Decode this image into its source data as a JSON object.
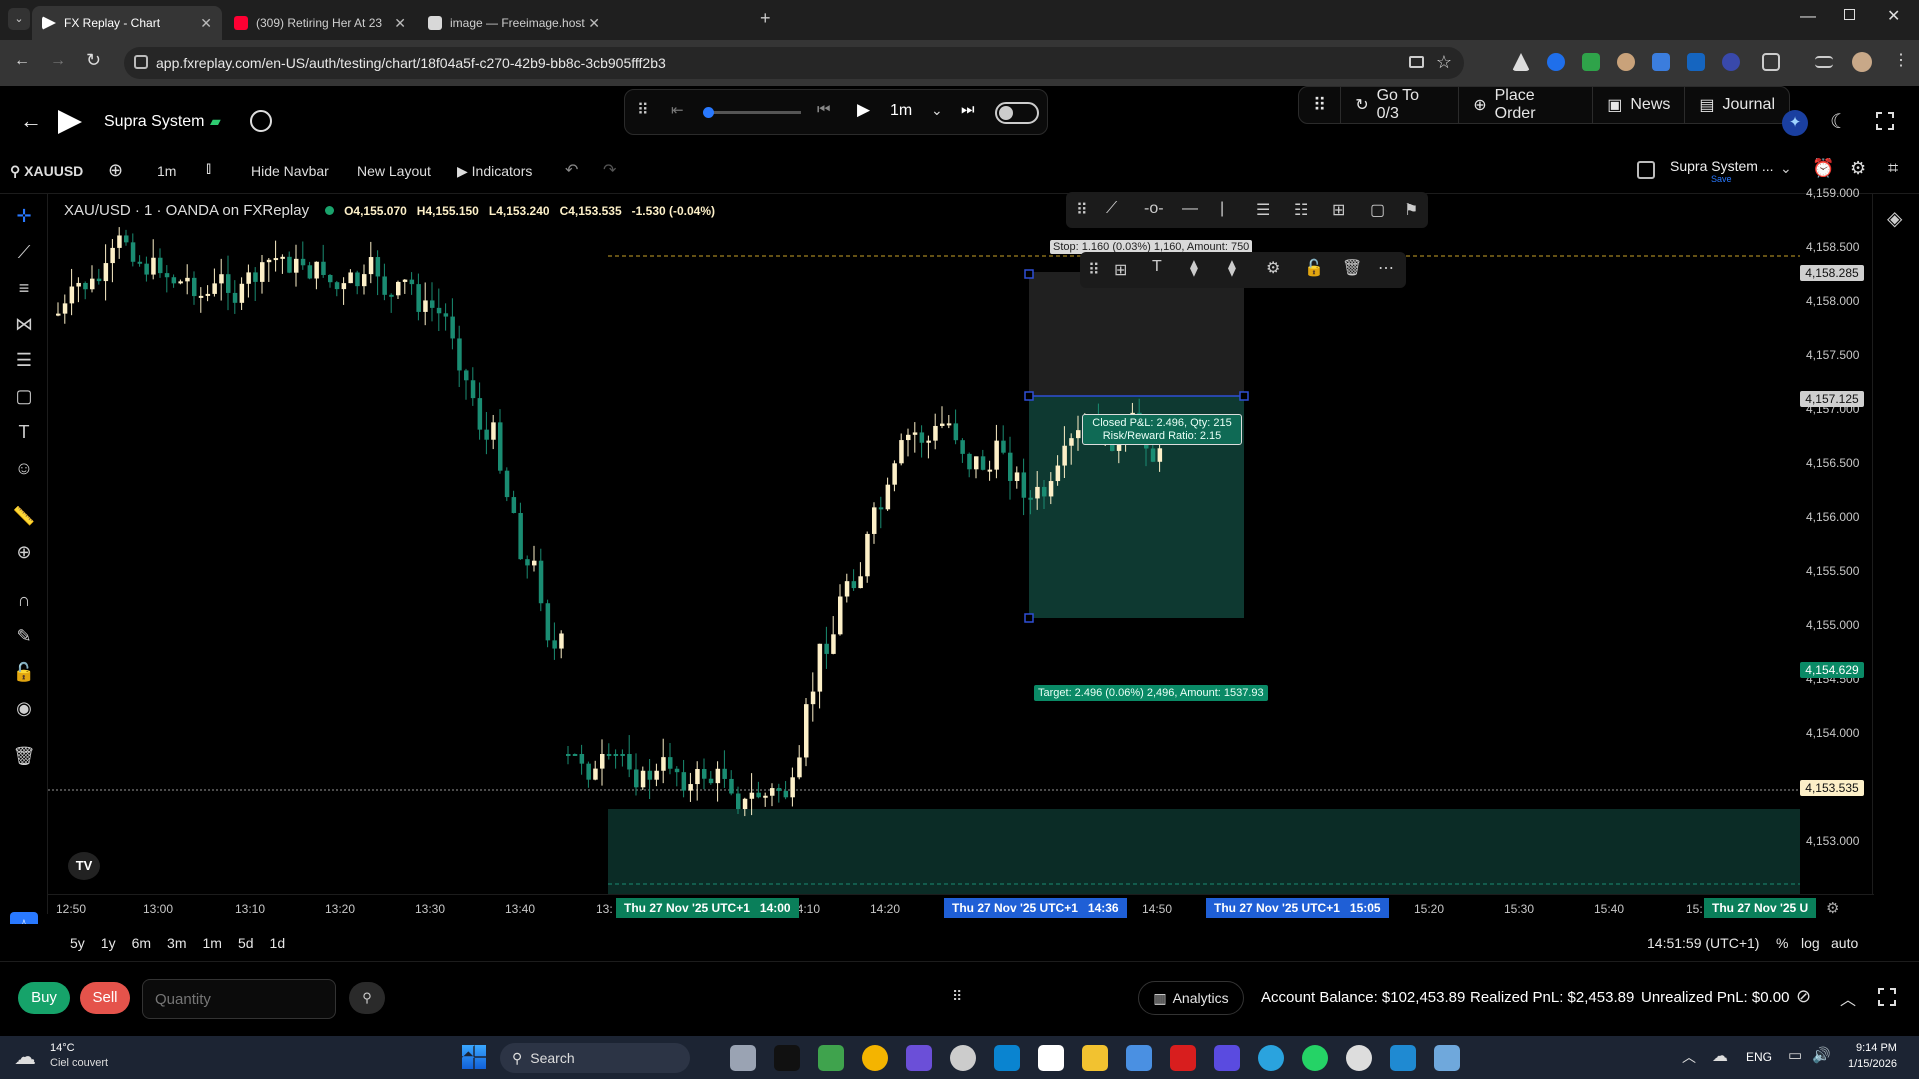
{
  "browser": {
    "tabs": [
      {
        "label": "FX Replay - Chart",
        "active": true
      },
      {
        "label": "(309) Retiring Her At 23 From T",
        "active": false
      },
      {
        "label": "image — Freeimage.host",
        "active": false
      }
    ],
    "url": "app.fxreplay.com/en-US/auth/testing/chart/18f04a5f-c270-42b9-bb8c-3cb905fff2b3"
  },
  "app": {
    "title": "Supra System",
    "playback": {
      "timeframe": "1m"
    },
    "nav": {
      "goto": "Go To 0/3",
      "place_order": "Place Order",
      "news": "News",
      "journal": "Journal"
    },
    "layout_name": "Supra System ...",
    "layout_status": "Save"
  },
  "toolbar": {
    "symbol": "XAUUSD",
    "interval": "1m",
    "hide_navbar": "Hide Navbar",
    "new_layout": "New Layout",
    "indicators": "Indicators"
  },
  "legend": {
    "symbol_title": "XAU/USD · 1 · OANDA on FXReplay",
    "open": "O4,155.070",
    "high": "H4,155.150",
    "low": "L4,153.240",
    "close": "C4,153.535",
    "change": "-1.530 (-0.04%)"
  },
  "position": {
    "stop_label": "Stop: 1.160 (0.03%) 1,160, Amount: 750",
    "closed_label_line1": "Closed P&L: 2.496, Qty: 215",
    "closed_label_line2": "Risk/Reward Ratio: 2.15",
    "target_label": "Target: 2.496 (0.06%) 2,496, Amount: 1537.93"
  },
  "price_axis": {
    "labels": [
      "4,159.000",
      "4,158.500",
      "4,158.000",
      "4,157.500",
      "4,157.000",
      "4,156.500",
      "4,156.000",
      "4,155.500",
      "4,155.000",
      "4,154.500",
      "4,154.000",
      "4,153.000"
    ],
    "badges": [
      {
        "text": "4,158.285",
        "kind": "grey"
      },
      {
        "text": "4,157.125",
        "kind": "grey"
      },
      {
        "text": "4,154.629",
        "kind": "green"
      },
      {
        "text": "4,153.535",
        "kind": "light"
      }
    ]
  },
  "time_axis": {
    "labels": [
      "12:50",
      "13:00",
      "13:10",
      "13:20",
      "13:30",
      "13:40",
      "13:",
      "14:10",
      "14:20",
      "14:50",
      "15:20",
      "15:30",
      "15:40",
      "15:"
    ],
    "badges": [
      "Thu 27 Nov '25 UTC+1   14:00",
      "Thu 27 Nov '25 UTC+1   14:36",
      "Thu 27 Nov '25 UTC+1   15:05",
      "Thu 27 Nov '25 U"
    ]
  },
  "ranges": {
    "items": [
      "5y",
      "1y",
      "6m",
      "3m",
      "1m",
      "5d",
      "1d"
    ],
    "clock": "14:51:59 (UTC+1)",
    "percent": "%",
    "log": "log",
    "auto": "auto"
  },
  "trade": {
    "buy": "Buy",
    "sell": "Sell",
    "quantity_placeholder": "Quantity",
    "analytics": "Analytics",
    "account_balance": "Account Balance: $102,453.89",
    "realized_pnl": "Realized PnL: $2,453.89",
    "unrealized_pnl": "Unrealized PnL: $0.00"
  },
  "taskbar": {
    "weather_temp": "14°C",
    "weather_desc": "Ciel couvert",
    "search": "Search",
    "lang": "ENG",
    "time": "9:14 PM",
    "date": "1/15/2026"
  },
  "colors": {
    "bull": "#fdf0c8",
    "bear": "#1a8c72",
    "zone_green": "#0f3f36",
    "zone_grey": "#3a3a3a",
    "badge_green": "#0a7f5a",
    "buy": "#16a36a",
    "sell": "#e5534b"
  }
}
